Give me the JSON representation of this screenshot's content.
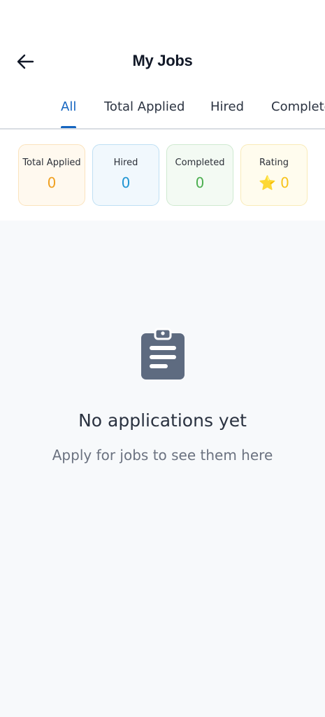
{
  "header": {
    "title": "My Jobs",
    "back_icon": "arrow-left-icon"
  },
  "tabs": [
    {
      "label": "All",
      "active": true
    },
    {
      "label": "Total Applied",
      "active": false
    },
    {
      "label": "Hired",
      "active": false
    },
    {
      "label": "Completed",
      "active": false
    }
  ],
  "stats": [
    {
      "label": "Total Applied",
      "value": "0",
      "color": "#f0a020",
      "bg": "#fff9ef",
      "border": "#fbe3bd"
    },
    {
      "label": "Hired",
      "value": "0",
      "color": "#2196d3",
      "bg": "#f1f8fd",
      "border": "#bfe0f4"
    },
    {
      "label": "Completed",
      "value": "0",
      "color": "#4caf50",
      "bg": "#f3faf3",
      "border": "#cfe9d0"
    },
    {
      "label": "Rating",
      "value": "0",
      "color": "#f7c31c",
      "bg": "#fffcee",
      "border": "#f9ebb8",
      "icon": "star-icon",
      "icon_glyph": "⭐"
    }
  ],
  "empty_state": {
    "icon": "clipboard-icon",
    "title": "No applications yet",
    "subtitle": "Apply for jobs to see them here"
  },
  "colors": {
    "accent": "#1565c0",
    "background": "#f7f9fb",
    "icon_gray": "#5e6b80"
  }
}
